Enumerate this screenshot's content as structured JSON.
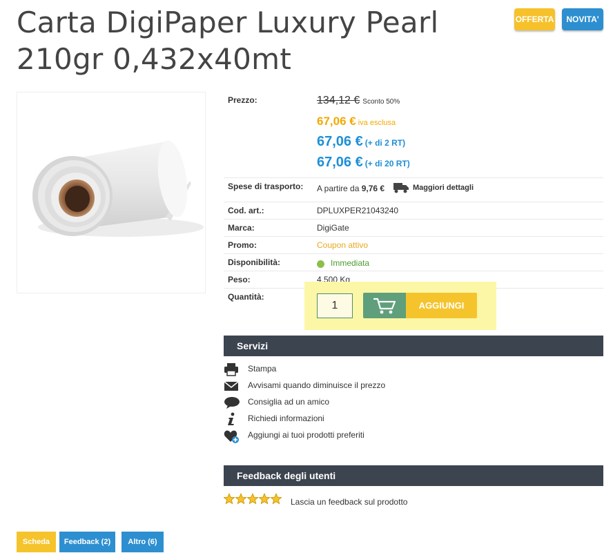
{
  "product": {
    "title": "Carta DigiPaper Luxury Pearl 210gr 0,432x40mt",
    "badges": {
      "offerta": "OFFERTA",
      "novita": "NOVITA'"
    }
  },
  "details": {
    "price_label": "Prezzo:",
    "price_old": "134,12 €",
    "discount": "Sconto 50%",
    "price_main": "67,06 €",
    "vat_note": "iva esclusa",
    "tiers": [
      {
        "price": "67,06 €",
        "note": "(+ di 2 RT)"
      },
      {
        "price": "67,06 €",
        "note": "(+ di 20 RT)"
      }
    ],
    "shipping_label": "Spese di trasporto:",
    "shipping_prefix": "A partire da",
    "shipping_value": "9,76 €",
    "shipping_more": "Maggiori dettagli",
    "code_label": "Cod. art.:",
    "code_value": "DPLUXPER21043240",
    "brand_label": "Marca:",
    "brand_value": "DigiGate",
    "promo_label": "Promo:",
    "promo_value": "Coupon attivo",
    "availability_label": "Disponibilità:",
    "availability_value": "Immediata",
    "weight_label": "Peso:",
    "weight_value": "4,500 Kg",
    "quantity_label": "Quantità:",
    "quantity_value": "1",
    "add_button": "AGGIUNGI"
  },
  "services": {
    "title": "Servizi",
    "items": [
      {
        "icon": "printer-icon",
        "label": "Stampa"
      },
      {
        "icon": "envelope-icon",
        "label": "Avvisami quando diminuisce il prezzo"
      },
      {
        "icon": "speech-bubble-icon",
        "label": "Consiglia ad un amico"
      },
      {
        "icon": "info-icon",
        "label": "Richiedi informazioni"
      },
      {
        "icon": "heart-plus-icon",
        "label": "Aggiungi ai tuoi prodotti preferiti"
      }
    ]
  },
  "feedback": {
    "title": "Feedback degli utenti",
    "rating_stars": 5,
    "link": "Lascia un feedback sul prodotto"
  },
  "tabs": [
    "Scheda",
    "Feedback (2)",
    "Altro (6)"
  ],
  "colors": {
    "yellow": "#f5c42c",
    "blue": "#1e8fd6",
    "dark_bar": "#3c4450",
    "green": "#5f9f7c",
    "highlight": "#fcf7a6"
  }
}
